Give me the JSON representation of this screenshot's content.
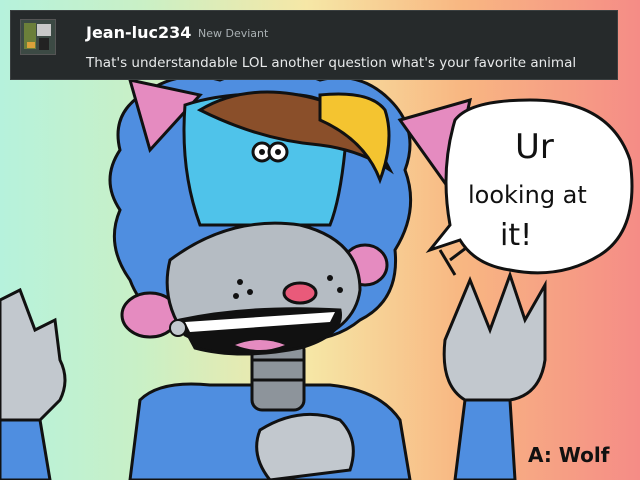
{
  "comment": {
    "username": "Jean-luc234",
    "role": "New Deviant",
    "text": "That's understandable LOL another question what's your favorite animal",
    "avatar_icon": "user-avatar"
  },
  "artwork": {
    "speech": [
      "Ur",
      "looking at",
      "it!"
    ],
    "signature": "A: Wolf"
  },
  "colors": {
    "comment_bg": "#262a2b",
    "fur_blue": "#4f8ee0",
    "face_cyan": "#4fc3ea",
    "ear_pink": "#e58bc0",
    "metal_gray": "#b5bcc3",
    "beak_yellow": "#f4c430",
    "hair_brown": "#8a4f2a"
  }
}
